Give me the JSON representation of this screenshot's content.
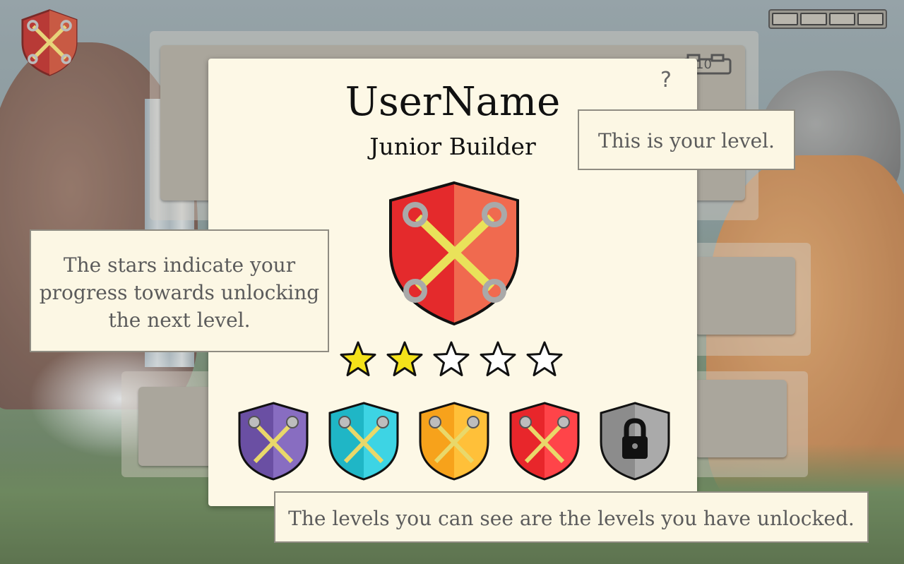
{
  "profile": {
    "username": "UserName",
    "rank_title": "Junior Builder",
    "help_label": "?",
    "brick_count": "10",
    "stars_filled": 2,
    "stars_total": 5,
    "current_badge_icon": "crossed-wrenches-icon"
  },
  "badges": [
    {
      "icon": "crossed-drills-icon",
      "color": "#6a4fa3",
      "locked": false
    },
    {
      "icon": "crossed-hammers-icon",
      "color": "#1fb6c6",
      "locked": false
    },
    {
      "icon": "crossed-screwdrivers-icon",
      "color": "#f7a21b",
      "locked": false
    },
    {
      "icon": "crossed-wrenches-icon",
      "color": "#e8262b",
      "locked": false
    },
    {
      "icon": "padlock-icon",
      "color": "#8c8c8c",
      "locked": true
    }
  ],
  "tooltips": {
    "level": "This is your level.",
    "stars": "The stars indicate your progress towards unlocking the next level.",
    "levels": "The levels you can see are the levels you have unlocked."
  },
  "colors": {
    "card_bg": "#fdf8e6",
    "star_fill": "#f4e21a",
    "shield_red_left": "#e42a2c",
    "shield_red_right": "#f06a4f"
  }
}
